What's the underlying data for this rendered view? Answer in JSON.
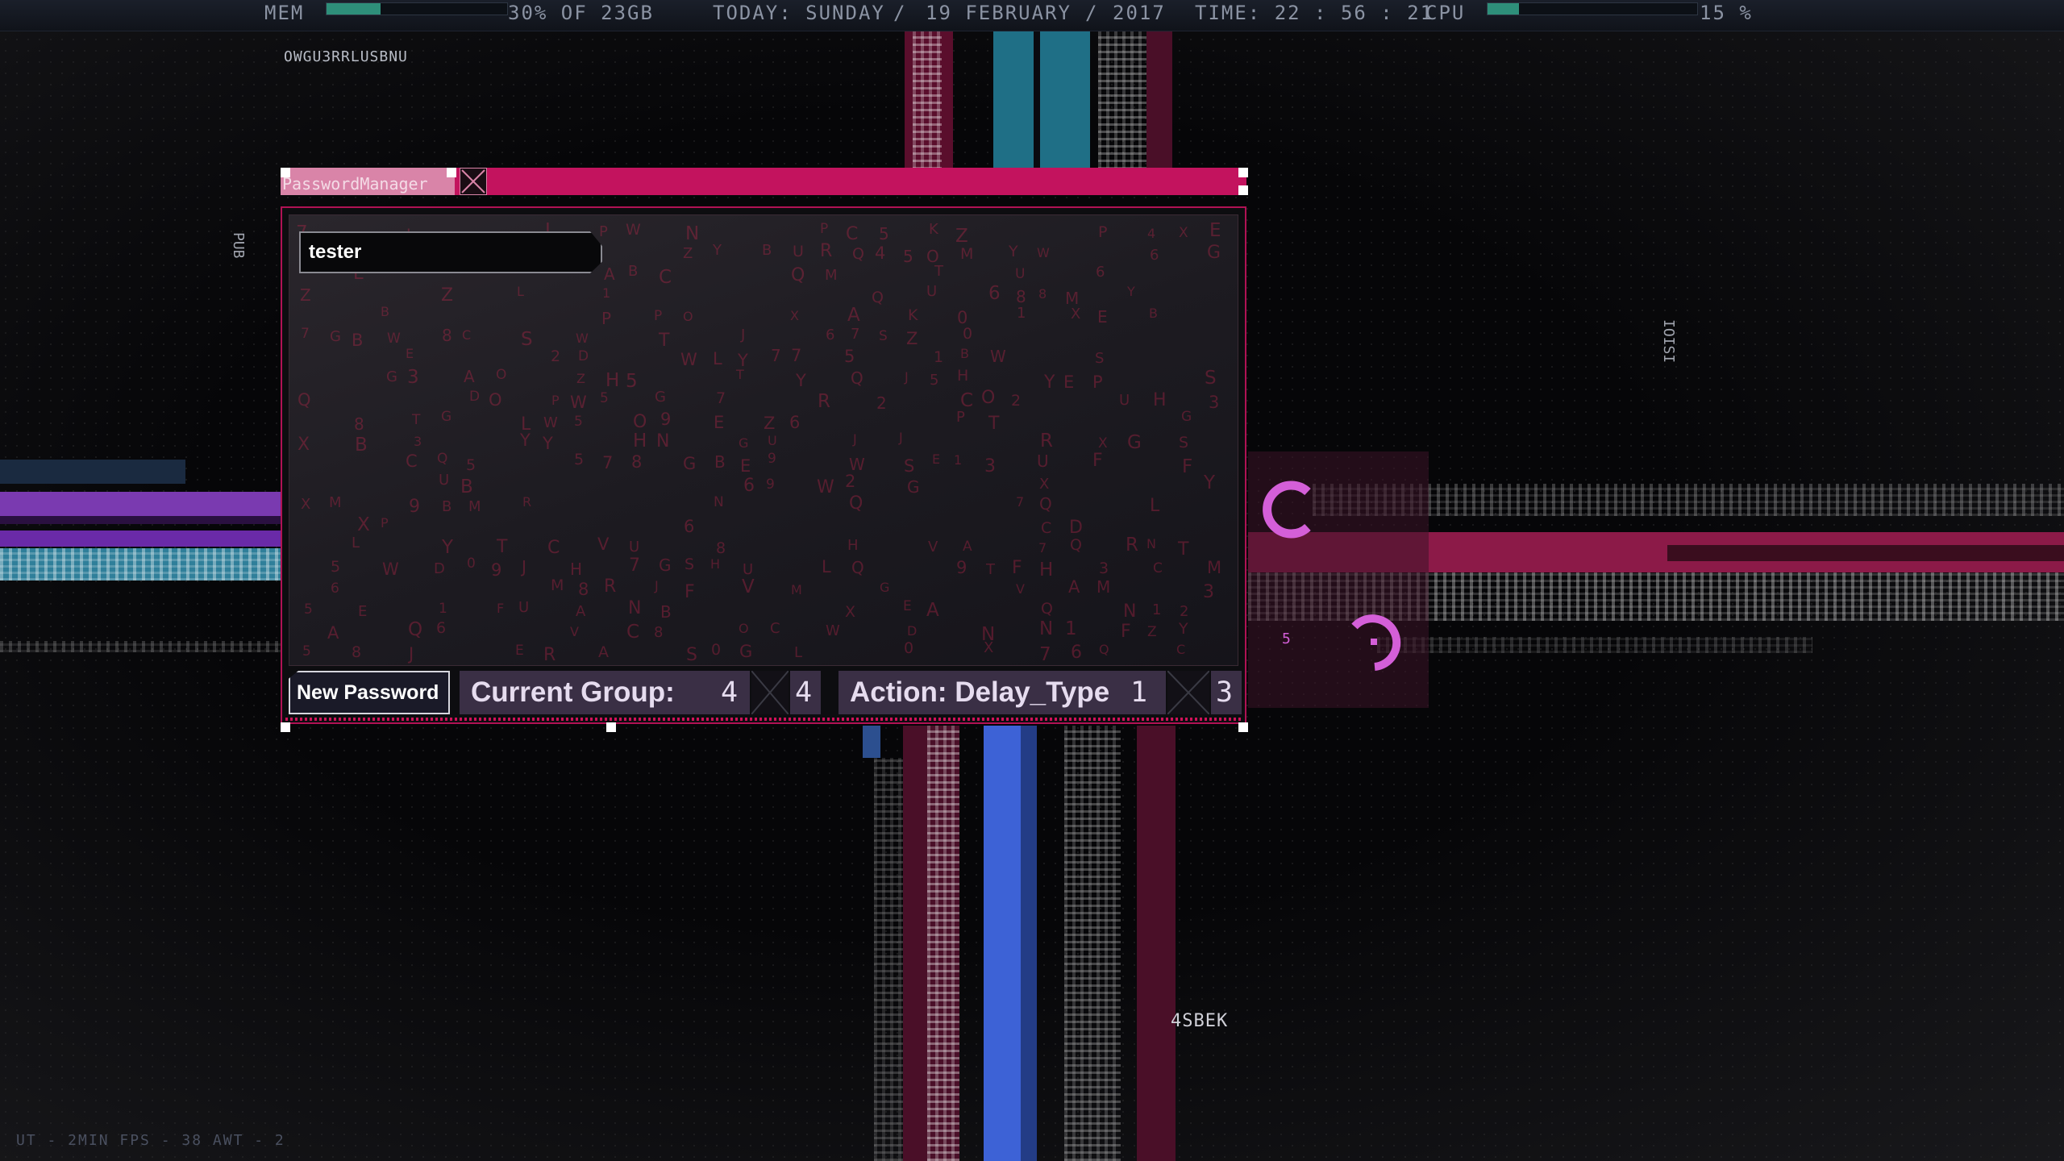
{
  "topbar": {
    "mem_label": "MEM",
    "mem_fraction": 0.3,
    "mem_text": "30% OF 23GB",
    "today_text": "TODAY: SUNDAY",
    "sep1": "/",
    "date_text": "19 FEBRUARY",
    "sep2": "/",
    "year_text": "2017",
    "time_text": "TIME: 22 : 56 : 21",
    "cpu_label": "CPU",
    "cpu_fraction": 0.15,
    "cpu_text": "15 %"
  },
  "corner": {
    "top_left_code": "OWGU3RRLUSBNU",
    "side_left": "PUB",
    "side_right": "IOISI",
    "bottom_right_code": "4SBEK",
    "status_line": "UT - 2MIN   FPS - 38   AWT - 2",
    "spinner_digit": "5"
  },
  "window": {
    "title": "PasswordManager",
    "entry_text": "tester",
    "new_password_label": "New Password",
    "current_group_label": "Current Group:",
    "current_group_value": "4",
    "group_count": "4",
    "action_label": "Action: Delay_Type",
    "action_value": "1",
    "action_count": "3"
  },
  "colors": {
    "accent": "#c3135e",
    "title_tab": "#d984a8",
    "bar_fill": "#2e8f7a",
    "segment_bg": "#3a2f45",
    "spinner": "#d45fd8"
  }
}
